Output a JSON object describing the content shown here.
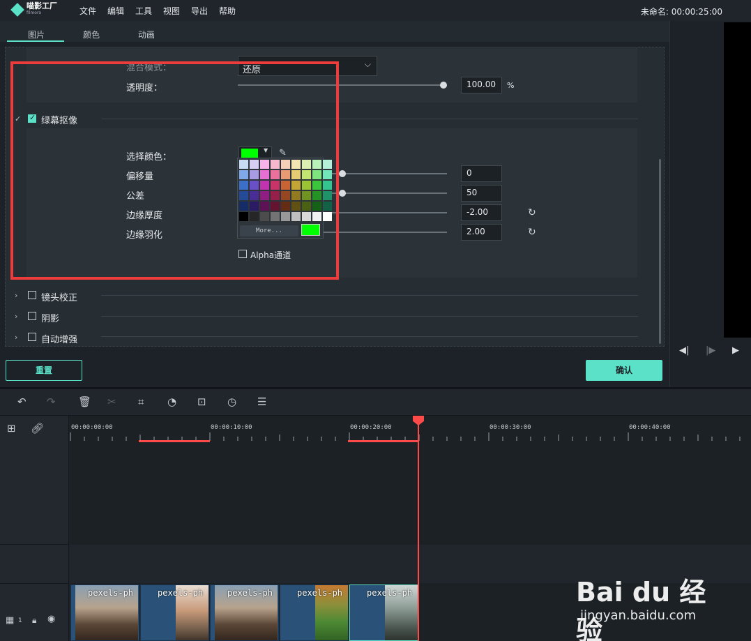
{
  "app": {
    "brand": "喵影工厂",
    "brand_sub": "filmora",
    "project_title": "未命名: 00:00:25:00"
  },
  "menu": [
    "文件",
    "编辑",
    "工具",
    "视图",
    "导出",
    "帮助"
  ],
  "tabs": [
    {
      "label": "图片",
      "active": true
    },
    {
      "label": "颜色",
      "active": false
    },
    {
      "label": "动画",
      "active": false
    }
  ],
  "blend": {
    "label": "混合模式：",
    "value": "还原"
  },
  "opacity": {
    "label": "透明度：",
    "value": "100.00",
    "unit": "%",
    "level": 1.0
  },
  "chroma": {
    "section_label": "绿幕抠像",
    "checked": true,
    "select_color_label": "选择颜色：",
    "selected_color": "#00ff00",
    "offset": {
      "label": "偏移量",
      "value": "0"
    },
    "tolerance": {
      "label": "公差",
      "value": "50"
    },
    "edge_thickness": {
      "label": "边缘厚度",
      "value": "-2.00"
    },
    "edge_feather": {
      "label": "边缘羽化",
      "value": "2.00"
    },
    "alpha_label": "Alpha通道",
    "alpha_checked": false
  },
  "picker": {
    "more_label": "More...",
    "rows": [
      [
        "#c9daf5",
        "#d6cff3",
        "#f5b3e9",
        "#f6b8cd",
        "#f6cfb8",
        "#f3e5b3",
        "#dcefb3",
        "#b9efb9",
        "#b3efd9"
      ],
      [
        "#7fa9e8",
        "#a79be6",
        "#e56fd3",
        "#e8729b",
        "#e89a72",
        "#e6cc72",
        "#c2e572",
        "#7fe57f",
        "#72e5b9"
      ],
      [
        "#3c6fc8",
        "#6a50c6",
        "#c233b0",
        "#c83468",
        "#c86434",
        "#c4a434",
        "#9ac434",
        "#3cc43c",
        "#34c490"
      ],
      [
        "#244a98",
        "#482d96",
        "#901d82",
        "#96204a",
        "#964620",
        "#917a20",
        "#709220",
        "#249224",
        "#20926a"
      ],
      [
        "#152c66",
        "#2b1a64",
        "#5f1156",
        "#641330",
        "#642c13",
        "#615013",
        "#4a6113",
        "#156115",
        "#136147"
      ],
      [
        "#000000",
        "#262626",
        "#4c4c4c",
        "#737373",
        "#999999",
        "#bfbfbf",
        "#d9d9d9",
        "#f2f2f2",
        "#ffffff"
      ]
    ]
  },
  "sections": [
    {
      "label": "镜头校正",
      "checked": false
    },
    {
      "label": "阴影",
      "checked": false
    },
    {
      "label": "自动增强",
      "checked": false
    }
  ],
  "buttons": {
    "reset": "重置",
    "ok": "确认"
  },
  "ruler": [
    "00:00:00:00",
    "00:00:10:00",
    "00:00:20:00",
    "00:00:30:00",
    "00:00:40:00"
  ],
  "track": {
    "number": "1"
  },
  "clips": [
    {
      "name": "pexels-ph"
    },
    {
      "name": "pexels-ph"
    },
    {
      "name": "pexels-ph"
    },
    {
      "name": "pexels-ph"
    },
    {
      "name": "pexels-ph"
    }
  ],
  "watermark": {
    "main": "Bai du 经验",
    "url": "jingyan.baidu.com"
  }
}
